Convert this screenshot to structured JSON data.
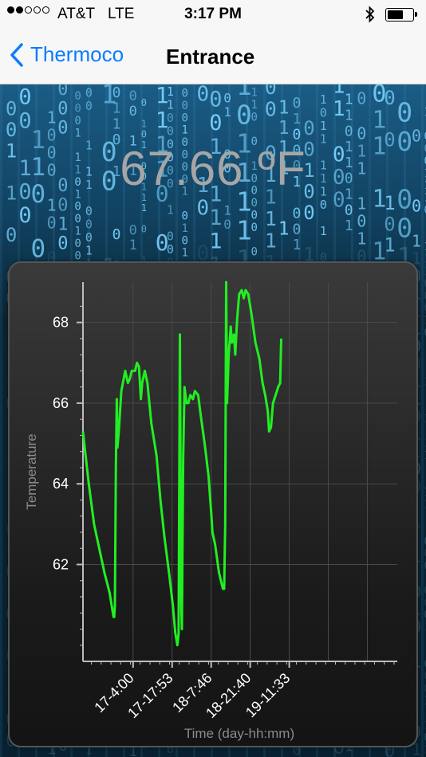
{
  "status_bar": {
    "signal_dots": [
      true,
      true,
      false,
      false,
      false
    ],
    "carrier": "AT&T",
    "network": "LTE",
    "time": "3:17 PM",
    "bluetooth_icon": "bluetooth-icon",
    "battery_level": 0.65
  },
  "nav": {
    "back_label": "Thermoco",
    "title": "Entrance"
  },
  "reading": "67.66 ºF",
  "chart_data": {
    "type": "line",
    "title": "",
    "xlabel": "Time (day-hh:mm)",
    "ylabel": "Temperature",
    "ylim": [
      59.6,
      69.0
    ],
    "yticks": [
      62,
      64,
      66,
      68
    ],
    "xticks": [
      "17-4:00",
      "17-17:53",
      "18-7:46",
      "18-21:40",
      "19-11:33"
    ],
    "xlim_minutes": [
      -145,
      2270
    ],
    "xtick_minutes": [
      240,
      1073,
      1906,
      2740,
      3573
    ],
    "grid": true,
    "line_color": "#22ee22",
    "series": [
      {
        "name": "",
        "points": [
          [
            -145,
            65.3
          ],
          [
            -125,
            64.7
          ],
          [
            -100,
            64.0
          ],
          [
            -60,
            63.0
          ],
          [
            -20,
            62.4
          ],
          [
            20,
            61.8
          ],
          [
            60,
            61.3
          ],
          [
            90,
            60.7
          ],
          [
            95,
            60.7
          ],
          [
            100,
            61.0
          ],
          [
            108,
            64.5
          ],
          [
            115,
            66.1
          ],
          [
            120,
            64.9
          ],
          [
            130,
            65.3
          ],
          [
            150,
            66.3
          ],
          [
            180,
            66.8
          ],
          [
            200,
            66.5
          ],
          [
            215,
            66.6
          ],
          [
            230,
            66.8
          ],
          [
            255,
            66.8
          ],
          [
            270,
            67.0
          ],
          [
            285,
            66.9
          ],
          [
            300,
            66.1
          ],
          [
            310,
            66.5
          ],
          [
            330,
            66.8
          ],
          [
            350,
            66.5
          ],
          [
            380,
            65.5
          ],
          [
            420,
            64.7
          ],
          [
            450,
            63.6
          ],
          [
            480,
            62.7
          ],
          [
            520,
            61.7
          ],
          [
            545,
            61.0
          ],
          [
            565,
            60.3
          ],
          [
            580,
            60.0
          ],
          [
            590,
            60.3
          ],
          [
            600,
            67.7
          ],
          [
            610,
            61.0
          ],
          [
            615,
            60.4
          ],
          [
            625,
            64.6
          ],
          [
            635,
            66.4
          ],
          [
            650,
            66.0
          ],
          [
            665,
            66.0
          ],
          [
            680,
            66.2
          ],
          [
            700,
            66.1
          ],
          [
            715,
            66.3
          ],
          [
            740,
            66.2
          ],
          [
            760,
            65.7
          ],
          [
            790,
            65.0
          ],
          [
            820,
            64.2
          ],
          [
            840,
            63.3
          ],
          [
            850,
            62.8
          ],
          [
            870,
            62.5
          ],
          [
            900,
            61.8
          ],
          [
            930,
            61.4
          ],
          [
            940,
            61.4
          ],
          [
            948,
            63.0
          ],
          [
            955,
            69.0
          ],
          [
            962,
            66.0
          ],
          [
            975,
            67.2
          ],
          [
            990,
            67.9
          ],
          [
            1000,
            67.5
          ],
          [
            1015,
            67.7
          ],
          [
            1025,
            67.2
          ],
          [
            1040,
            68.1
          ],
          [
            1055,
            68.7
          ],
          [
            1075,
            68.8
          ],
          [
            1090,
            68.6
          ],
          [
            1105,
            68.8
          ],
          [
            1125,
            68.7
          ],
          [
            1150,
            68.2
          ],
          [
            1180,
            67.5
          ],
          [
            1210,
            67.1
          ],
          [
            1235,
            66.5
          ],
          [
            1255,
            66.2
          ],
          [
            1275,
            65.8
          ],
          [
            1285,
            65.3
          ],
          [
            1300,
            65.4
          ],
          [
            1315,
            66.0
          ],
          [
            1335,
            66.2
          ],
          [
            1355,
            66.4
          ],
          [
            1370,
            66.5
          ],
          [
            1378,
            67.6
          ]
        ]
      }
    ]
  },
  "background_icon": "binary-matrix-background"
}
